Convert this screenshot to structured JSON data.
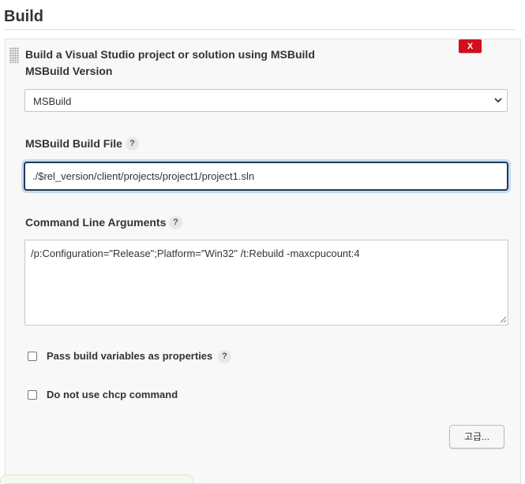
{
  "section": {
    "title": "Build"
  },
  "step": {
    "title": "Build a Visual Studio project or solution using MSBuild",
    "delete_label": "X",
    "drag_icon": "drag-handle-icon"
  },
  "msbuild_version": {
    "label": "MSBuild Version",
    "selected": "MSBuild"
  },
  "build_file": {
    "label": "MSBuild Build File",
    "help": "?",
    "value": "./$rel_version/client/projects/project1/project1.sln"
  },
  "cmd_args": {
    "label": "Command Line Arguments",
    "help": "?",
    "value": "/p:Configuration=\"Release\";Platform=\"Win32\" /t:Rebuild -maxcpucount:4"
  },
  "options": [
    {
      "label": "Pass build variables as properties",
      "checked": false,
      "help": "?"
    },
    {
      "label": "Do not use chcp command",
      "checked": false
    }
  ],
  "advanced_button": "고급...",
  "colors": {
    "delete_red": "#d20d1c",
    "focus_border": "#1c3a56",
    "focus_glow": "#c7dbef"
  }
}
